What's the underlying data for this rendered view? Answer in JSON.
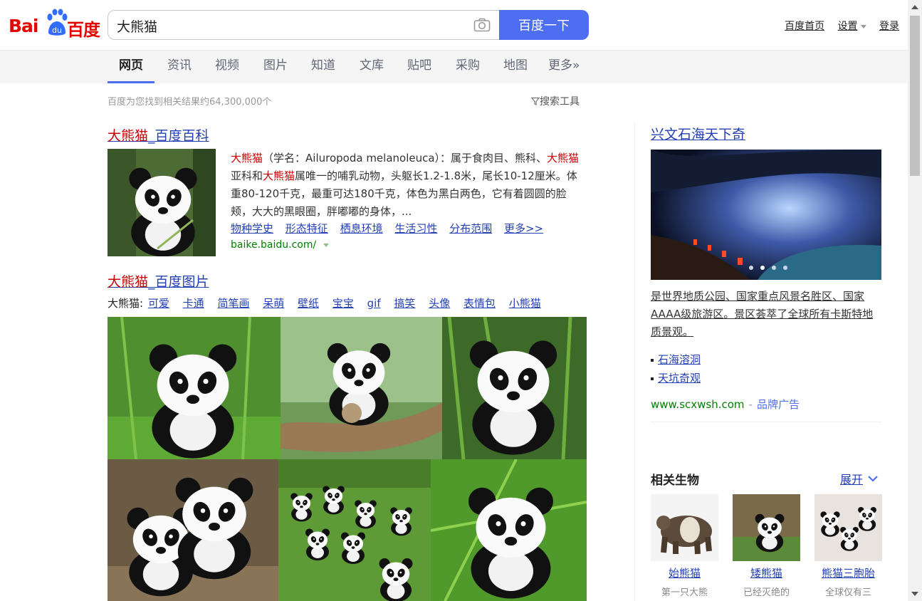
{
  "brand": {
    "logo_latin": "Bai",
    "logo_paw_text": "du",
    "logo_cn": "百度",
    "red": "#e10602",
    "blue": "#4e6ef2"
  },
  "search": {
    "query": "大熊猫",
    "button_label": "百度一下"
  },
  "top_links": {
    "home": "百度首页",
    "settings": "设置",
    "login": "登录"
  },
  "tabs": [
    "网页",
    "资讯",
    "视频",
    "图片",
    "知道",
    "文库",
    "贴吧",
    "采购",
    "地图",
    "更多»"
  ],
  "stats": {
    "result_count": "百度为您找到相关结果约64,300,000个",
    "search_tools": "搜索工具"
  },
  "baike": {
    "title_kw": "大熊猫",
    "title_rest": "_百度百科",
    "desc": [
      {
        "t": "大熊猫",
        "em": true
      },
      {
        "t": "（学名：Ailuropoda melanoleuca）：属于食肉目、熊科、",
        "em": false
      },
      {
        "t": "大熊猫",
        "em": true
      },
      {
        "t": "亚科和",
        "em": false
      },
      {
        "t": "大熊猫",
        "em": true
      },
      {
        "t": "属唯一的哺乳动物，头躯长1.2-1.8米，尾长10-12厘米。体重80-120千克，最重可达180千克，体色为黑白两色，它有着圆圆的脸颊，大大的黑眼圈，胖嘟嘟的身体，...",
        "em": false
      }
    ],
    "links": [
      "物种学史",
      "形态特征",
      "栖息环境",
      "生活习性",
      "分布范围",
      "更多>>"
    ],
    "url": "baike.baidu.com/"
  },
  "images": {
    "title_kw": "大熊猫",
    "title_rest": "_百度图片",
    "tag_prefix": "大熊猫:",
    "tags": [
      "可爱",
      "卡通",
      "简笔画",
      "呆萌",
      "壁纸",
      "宝宝",
      "gif",
      "搞笑",
      "头像",
      "表情包",
      "小熊猫"
    ]
  },
  "ad": {
    "title": "兴文石海天下奇",
    "desc": "是世界地质公园、国家重点风景名胜区、国家AAAA级旅游区。景区荟萃了全球所有卡斯特地质景观。",
    "links": [
      "石海溶洞",
      "天坑奇观"
    ],
    "url": "www.scxwsh.com",
    "sep": "-",
    "brand_tag": "品牌广告"
  },
  "related": {
    "title": "相关生物",
    "expand": "展开",
    "items": [
      {
        "name": "始熊猫",
        "desc": "第一只大熊"
      },
      {
        "name": "矮熊猫",
        "desc": "已经灭绝的"
      },
      {
        "name": "熊猫三胞胎",
        "desc": "全球仅有三"
      }
    ]
  }
}
